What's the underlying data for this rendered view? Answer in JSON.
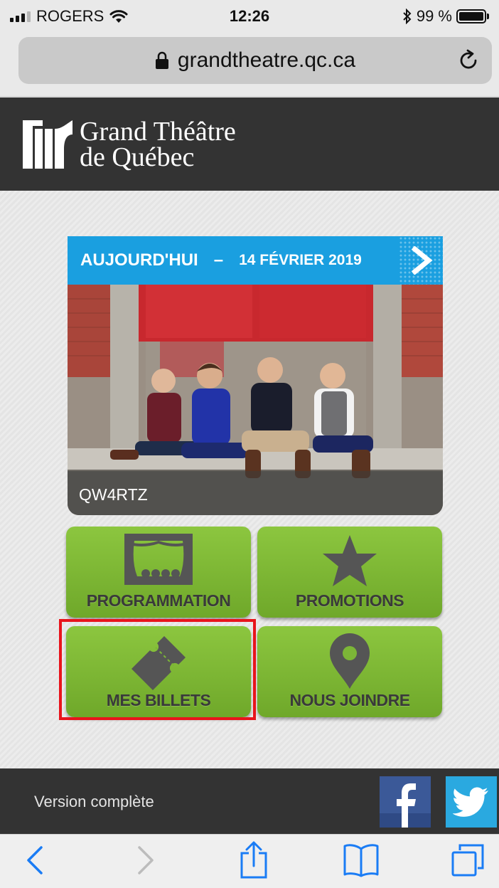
{
  "status_bar": {
    "carrier": "ROGERS",
    "time": "12:26",
    "battery_percent": "99 %",
    "battery_level": 0.99
  },
  "browser": {
    "url": "grandtheatre.qc.ca"
  },
  "site": {
    "logo_line1": "Grand Théâtre",
    "logo_line2": "de Québec"
  },
  "featured": {
    "label_today": "AUJOURD'HUI",
    "separator": "–",
    "date": "14 FÉVRIER 2019",
    "caption": "QW4RTZ"
  },
  "tiles": {
    "programmation": "PROGRAMMATION",
    "promotions": "PROMOTIONS",
    "mes_billets": "MES BILLETS",
    "nous_joindre": "NOUS JOINDRE"
  },
  "footer": {
    "full_version": "Version complète"
  },
  "colors": {
    "tile_green": "#8cc63f",
    "banner_blue": "#1a9fe0",
    "header_dark": "#333333",
    "highlight_red": "#e8141c",
    "ios_blue": "#1a7cf5"
  },
  "icons": {
    "theatre": "stage-icon",
    "promo": "star-icon",
    "billets": "ticket-icon",
    "joindre": "map-pin-icon"
  }
}
